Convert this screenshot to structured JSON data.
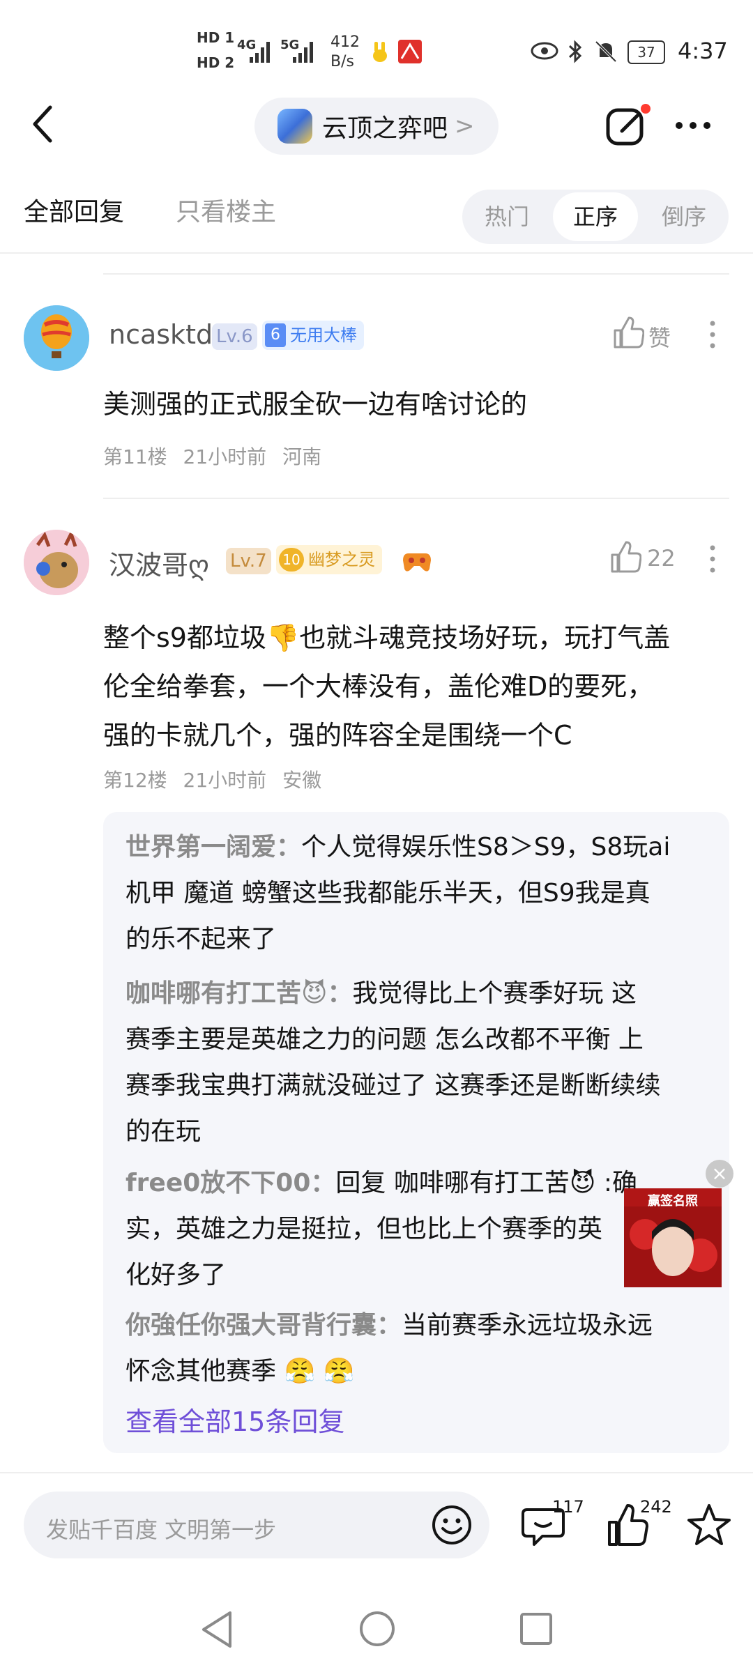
{
  "status_bar": {
    "hd1": "HD 1",
    "hd2": "HD 2",
    "net1": "4G",
    "net2": "5G",
    "speed_value": "412",
    "speed_unit": "B/s",
    "battery": "37",
    "time": "4:37"
  },
  "nav": {
    "forum_name": "云顶之弈吧",
    "forum_chevron": ">"
  },
  "tabs": {
    "all_replies": "全部回复",
    "owner_only": "只看楼主",
    "sort": [
      "热门",
      "正序",
      "倒序"
    ],
    "sort_selected": "正序"
  },
  "posts": [
    {
      "username": "ncasktd",
      "level": "Lv.6",
      "badge_number": "6",
      "badge_label": "无用大棒",
      "like_label": "赞",
      "content": "美测强的正式服全砍一边有啥讨论的",
      "floor": "第11楼",
      "time": "21小时前",
      "location": "河南"
    },
    {
      "username": "汉波哥ღ",
      "level": "Lv.7",
      "badge_number": "10",
      "badge_label": "幽梦之灵",
      "like_count": "22",
      "content_lines": [
        "整个s9都垃圾👎也就斗魂竞技场好玩，玩打气盖",
        "伦全给拳套，一个大棒没有，盖伦难D的要死，",
        "强的卡就几个，强的阵容全是围绕一个C"
      ],
      "floor": "第12楼",
      "time": "21小时前",
      "location": "安徽"
    }
  ],
  "replies": [
    {
      "author": "世界第一阔爱：",
      "lines": [
        "个人觉得娱乐性S8＞S9，S8玩ai",
        "机甲 魔道 螃蟹这些我都能乐半天，但S9我是真",
        "的乐不起来了"
      ]
    },
    {
      "author": "咖啡哪有打工苦😈：",
      "lines": [
        "我觉得比上个赛季好玩 这",
        "赛季主要是英雄之力的问题 怎么改都不平衡 上",
        "赛季我宝典打满就没碰过了 这赛季还是断断续续",
        "的在玩"
      ]
    },
    {
      "author": "free0放不下00：",
      "lines": [
        "回复 咖啡哪有打工苦😈 :确",
        "实，英雄之力是挺拉，但也比上个赛季的英",
        "化好多了"
      ]
    },
    {
      "author": "你強任你强大哥背行囊：",
      "lines": [
        "当前赛季永远垃圾永远",
        "怀念其他赛季 😤 😤"
      ]
    }
  ],
  "view_all_replies": "查看全部15条回复",
  "ad": {
    "label": "赢签名照"
  },
  "bottom_bar": {
    "input_placeholder": "发贴千百度 文明第一步",
    "comment_count": "117",
    "like_count": "242"
  },
  "colors": {
    "accent_purple": "#6f4fd8",
    "level_bg": "#f4e1c8",
    "badge_blue": "#e6f0ff",
    "badge_gold": "#fff3d6",
    "notification_red": "#ff3b30"
  }
}
